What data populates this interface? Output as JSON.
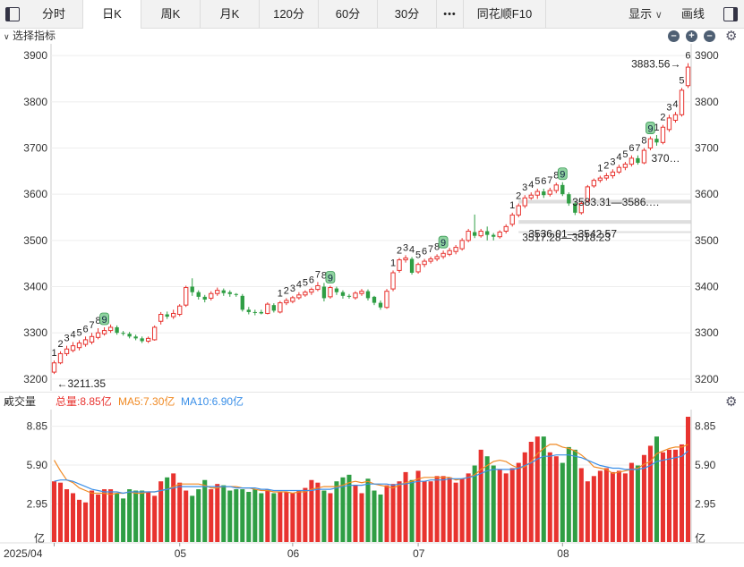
{
  "toolbar": {
    "tabs": [
      {
        "label": "分时"
      },
      {
        "label": "日K",
        "active": true
      },
      {
        "label": "周K"
      },
      {
        "label": "月K"
      },
      {
        "label": "120分"
      },
      {
        "label": "60分"
      },
      {
        "label": "30分"
      },
      {
        "label": "•••"
      },
      {
        "label": "同花顺F10"
      }
    ],
    "display_label": "显示",
    "draw_label": "画线"
  },
  "price_panel": {
    "title": "选择指标",
    "buttons": [
      "–",
      "+",
      "–"
    ]
  },
  "volume_panel": {
    "title": "成交量",
    "total": "总量:8.85亿",
    "ma5": "MA5:7.30亿",
    "ma10": "MA10:6.90亿"
  },
  "colors": {
    "up": "#e8332f",
    "down": "#2f9e44",
    "ma5": "#f08a24",
    "ma10": "#3a8fe8"
  },
  "chart_data": [
    {
      "type": "candlestick",
      "ylim": [
        3190,
        3910
      ],
      "y_ticks": [
        3200,
        3300,
        3400,
        3500,
        3600,
        3700,
        3800,
        3900
      ],
      "y_tick_labels": [
        "3200",
        "3300",
        "3400",
        "3500",
        "3600",
        "3700",
        "3800",
        "3900"
      ],
      "x_labels": [
        {
          "index": 0,
          "label": "2025/04"
        },
        {
          "index": 20,
          "label": "05"
        },
        {
          "index": 38,
          "label": "06"
        },
        {
          "index": 58,
          "label": "07"
        },
        {
          "index": 81,
          "label": "08"
        }
      ],
      "ohlc": [
        [
          3215,
          3235,
          3211,
          3240
        ],
        [
          3235,
          3255,
          3232,
          3260
        ],
        [
          3255,
          3265,
          3250,
          3272
        ],
        [
          3262,
          3272,
          3258,
          3280
        ],
        [
          3268,
          3278,
          3262,
          3284
        ],
        [
          3275,
          3285,
          3270,
          3292
        ],
        [
          3280,
          3292,
          3275,
          3300
        ],
        [
          3290,
          3300,
          3286,
          3310
        ],
        [
          3298,
          3305,
          3294,
          3312
        ],
        [
          3305,
          3312,
          3300,
          3318
        ],
        [
          3312,
          3300,
          3296,
          3316
        ],
        [
          3300,
          3298,
          3294,
          3304
        ],
        [
          3298,
          3292,
          3288,
          3302
        ],
        [
          3292,
          3288,
          3284,
          3296
        ],
        [
          3288,
          3282,
          3278,
          3292
        ],
        [
          3282,
          3288,
          3278,
          3292
        ],
        [
          3285,
          3312,
          3283,
          3316
        ],
        [
          3325,
          3340,
          3318,
          3345
        ],
        [
          3340,
          3335,
          3330,
          3346
        ],
        [
          3335,
          3342,
          3330,
          3350
        ],
        [
          3340,
          3358,
          3336,
          3362
        ],
        [
          3360,
          3398,
          3356,
          3402
        ],
        [
          3400,
          3388,
          3380,
          3418
        ],
        [
          3388,
          3378,
          3372,
          3392
        ],
        [
          3378,
          3372,
          3366,
          3382
        ],
        [
          3375,
          3385,
          3370,
          3390
        ],
        [
          3385,
          3392,
          3380,
          3398
        ],
        [
          3392,
          3386,
          3380,
          3396
        ],
        [
          3388,
          3384,
          3378,
          3392
        ],
        [
          3384,
          3382,
          3378,
          3386
        ],
        [
          3380,
          3350,
          3346,
          3384
        ],
        [
          3350,
          3345,
          3340,
          3356
        ],
        [
          3345,
          3344,
          3338,
          3350
        ],
        [
          3345,
          3342,
          3340,
          3350
        ],
        [
          3342,
          3362,
          3340,
          3366
        ],
        [
          3360,
          3348,
          3344,
          3364
        ],
        [
          3345,
          3365,
          3342,
          3369
        ],
        [
          3365,
          3370,
          3360,
          3375
        ],
        [
          3368,
          3376,
          3364,
          3380
        ],
        [
          3376,
          3382,
          3372,
          3388
        ],
        [
          3382,
          3388,
          3378,
          3392
        ],
        [
          3388,
          3394,
          3382,
          3398
        ],
        [
          3394,
          3402,
          3390,
          3410
        ],
        [
          3400,
          3375,
          3368,
          3408
        ],
        [
          3378,
          3398,
          3374,
          3402
        ],
        [
          3396,
          3388,
          3382,
          3400
        ],
        [
          3388,
          3380,
          3374,
          3392
        ],
        [
          3380,
          3378,
          3374,
          3384
        ],
        [
          3376,
          3386,
          3372,
          3390
        ],
        [
          3385,
          3390,
          3380,
          3395
        ],
        [
          3390,
          3375,
          3370,
          3394
        ],
        [
          3378,
          3365,
          3360,
          3380
        ],
        [
          3365,
          3355,
          3350,
          3370
        ],
        [
          3355,
          3390,
          3352,
          3395
        ],
        [
          3395,
          3430,
          3390,
          3435
        ],
        [
          3435,
          3458,
          3430,
          3462
        ],
        [
          3458,
          3462,
          3452,
          3468
        ],
        [
          3460,
          3430,
          3426,
          3464
        ],
        [
          3432,
          3448,
          3428,
          3452
        ],
        [
          3448,
          3455,
          3442,
          3460
        ],
        [
          3455,
          3460,
          3450,
          3465
        ],
        [
          3460,
          3465,
          3455,
          3470
        ],
        [
          3465,
          3472,
          3460,
          3478
        ],
        [
          3470,
          3478,
          3466,
          3484
        ],
        [
          3476,
          3485,
          3470,
          3490
        ],
        [
          3482,
          3500,
          3478,
          3505
        ],
        [
          3500,
          3520,
          3496,
          3525
        ],
        [
          3518,
          3510,
          3505,
          3556
        ],
        [
          3510,
          3520,
          3506,
          3525
        ],
        [
          3520,
          3512,
          3500,
          3530
        ],
        [
          3512,
          3508,
          3500,
          3516
        ],
        [
          3508,
          3518,
          3504,
          3522
        ],
        [
          3520,
          3530,
          3515,
          3535
        ],
        [
          3535,
          3555,
          3530,
          3560
        ],
        [
          3555,
          3575,
          3550,
          3580
        ],
        [
          3575,
          3592,
          3570,
          3598
        ],
        [
          3592,
          3598,
          3588,
          3604
        ],
        [
          3598,
          3606,
          3590,
          3612
        ],
        [
          3606,
          3598,
          3592,
          3612
        ],
        [
          3600,
          3608,
          3595,
          3614
        ],
        [
          3608,
          3620,
          3602,
          3625
        ],
        [
          3620,
          3600,
          3596,
          3626
        ],
        [
          3600,
          3580,
          3575,
          3604
        ],
        [
          3580,
          3560,
          3555,
          3584
        ],
        [
          3560,
          3580,
          3556,
          3584
        ],
        [
          3585,
          3616,
          3582,
          3620
        ],
        [
          3618,
          3630,
          3614,
          3634
        ],
        [
          3630,
          3635,
          3625,
          3640
        ],
        [
          3635,
          3640,
          3630,
          3646
        ],
        [
          3640,
          3648,
          3634,
          3654
        ],
        [
          3648,
          3658,
          3644,
          3664
        ],
        [
          3658,
          3665,
          3652,
          3670
        ],
        [
          3665,
          3678,
          3660,
          3684
        ],
        [
          3678,
          3668,
          3664,
          3684
        ],
        [
          3668,
          3695,
          3665,
          3700
        ],
        [
          3700,
          3720,
          3695,
          3725
        ],
        [
          3720,
          3712,
          3705,
          3728
        ],
        [
          3712,
          3745,
          3708,
          3750
        ],
        [
          3740,
          3765,
          3735,
          3772
        ],
        [
          3760,
          3772,
          3755,
          3778
        ],
        [
          3772,
          3825,
          3768,
          3830
        ],
        [
          3835,
          3875,
          3830,
          3883.56
        ]
      ],
      "annotations": [
        {
          "text": "←3211.35",
          "index": 0,
          "price": 3211.35
        },
        {
          "text": "3883.56→",
          "index": 101,
          "price": 3883.56
        },
        {
          "text": "370…",
          "index": 100,
          "price": 3705
        },
        {
          "text": "3583.31—3586.…",
          "index": 82,
          "price": 3583
        },
        {
          "text": "3536.01—3542.57",
          "index": 75,
          "price": 3539
        },
        {
          "text": "3517.28—3518.23",
          "index": 74,
          "price": 3518
        }
      ],
      "td_sequences": [
        {
          "start": 0,
          "values": [
            1,
            2,
            3,
            4,
            5,
            6,
            7,
            8,
            9
          ]
        },
        {
          "start": 36,
          "values": [
            1,
            2,
            3,
            4,
            5,
            6,
            7,
            8,
            9
          ]
        },
        {
          "start": 54,
          "values": [
            1,
            2,
            3,
            4,
            5,
            6,
            7,
            8,
            9
          ]
        },
        {
          "start": 73,
          "values": [
            1,
            2,
            3,
            4,
            5,
            6,
            7,
            8,
            9
          ]
        },
        {
          "start": 87,
          "values": [
            1,
            2,
            3,
            4,
            5,
            6,
            7,
            8,
            9
          ]
        },
        {
          "start": 96,
          "values": [
            1,
            2,
            3,
            4,
            5,
            6
          ]
        }
      ]
    },
    {
      "type": "bar",
      "ylim": [
        0,
        9.5
      ],
      "y_ticks": [
        2.95,
        5.9,
        8.85
      ],
      "y_tick_labels": [
        "2.95",
        "5.90",
        "8.85"
      ],
      "unit_label": "亿",
      "values": [
        4.6,
        4.5,
        4.0,
        3.7,
        3.2,
        3.0,
        3.9,
        3.6,
        4.0,
        4.0,
        3.7,
        3.3,
        4.0,
        3.9,
        3.9,
        3.8,
        3.5,
        4.6,
        4.9,
        5.2,
        4.5,
        3.9,
        3.5,
        4.0,
        4.7,
        4.0,
        4.4,
        4.3,
        3.9,
        4.0,
        4.0,
        3.8,
        4.0,
        3.7,
        4.0,
        3.7,
        3.8,
        3.8,
        3.7,
        3.9,
        4.1,
        4.7,
        4.5,
        3.9,
        3.7,
        4.6,
        4.9,
        5.1,
        4.3,
        3.7,
        4.8,
        3.9,
        3.6,
        4.3,
        4.4,
        4.6,
        5.3,
        4.7,
        5.4,
        4.6,
        4.6,
        5.0,
        5.0,
        4.9,
        4.5,
        4.8,
        5.2,
        5.8,
        7.0,
        6.5,
        5.8,
        5.5,
        5.2,
        5.6,
        6.0,
        6.8,
        7.6,
        8.0,
        8.0,
        6.8,
        6.5,
        6.0,
        7.2,
        7.0,
        5.6,
        4.6,
        5.0,
        5.4,
        5.6,
        5.3,
        5.4,
        5.2,
        6.0,
        5.8,
        6.6,
        7.3,
        8.0,
        6.8,
        7.0,
        7.0,
        7.4,
        9.5
      ],
      "ma5": [
        6.2,
        5.4,
        4.7,
        4.5,
        4.1,
        3.9,
        3.7,
        3.7,
        3.7,
        3.6,
        3.7,
        3.7,
        3.8,
        3.7,
        3.7,
        3.8,
        3.8,
        3.9,
        4.0,
        4.2,
        4.4,
        4.4,
        4.4,
        4.4,
        4.3,
        4.1,
        4.1,
        4.2,
        4.2,
        4.2,
        4.1,
        4.1,
        4.0,
        3.9,
        3.9,
        3.8,
        3.8,
        3.8,
        3.7,
        3.8,
        3.8,
        4.0,
        4.1,
        4.2,
        4.2,
        4.2,
        4.3,
        4.5,
        4.6,
        4.5,
        4.6,
        4.4,
        4.3,
        4.2,
        4.1,
        4.3,
        4.5,
        4.6,
        4.8,
        4.9,
        4.9,
        4.9,
        4.9,
        4.9,
        4.7,
        4.8,
        4.9,
        5.1,
        5.5,
        5.8,
        6.1,
        6.2,
        6.1,
        5.8,
        5.6,
        5.7,
        6.1,
        6.7,
        7.1,
        7.4,
        7.4,
        7.2,
        7.1,
        6.9,
        6.6,
        6.2,
        5.7,
        5.6,
        5.5,
        5.2,
        5.3,
        5.4,
        5.5,
        5.6,
        5.9,
        6.1,
        6.7,
        6.9,
        7.1,
        7.2,
        7.2,
        7.4
      ],
      "ma10": [
        4.6,
        4.7,
        4.7,
        4.6,
        4.4,
        4.2,
        4.0,
        3.9,
        3.8,
        3.8,
        3.8,
        3.7,
        3.8,
        3.8,
        3.8,
        3.8,
        3.8,
        3.9,
        4.0,
        4.1,
        4.2,
        4.2,
        4.2,
        4.2,
        4.2,
        4.2,
        4.2,
        4.2,
        4.2,
        4.1,
        4.1,
        4.1,
        4.1,
        4.0,
        4.0,
        3.9,
        3.9,
        3.9,
        3.9,
        3.9,
        3.9,
        3.9,
        4.0,
        4.0,
        4.0,
        4.1,
        4.2,
        4.3,
        4.3,
        4.3,
        4.4,
        4.4,
        4.4,
        4.4,
        4.3,
        4.4,
        4.4,
        4.5,
        4.6,
        4.6,
        4.7,
        4.7,
        4.7,
        4.8,
        4.8,
        4.8,
        4.9,
        5.0,
        5.2,
        5.4,
        5.5,
        5.5,
        5.5,
        5.5,
        5.6,
        5.8,
        6.0,
        6.3,
        6.5,
        6.5,
        6.6,
        6.6,
        6.6,
        6.5,
        6.4,
        6.2,
        6.0,
        5.8,
        5.7,
        5.6,
        5.6,
        5.5,
        5.5,
        5.5,
        5.6,
        5.8,
        6.1,
        6.2,
        6.3,
        6.4,
        6.5,
        6.9
      ]
    }
  ]
}
